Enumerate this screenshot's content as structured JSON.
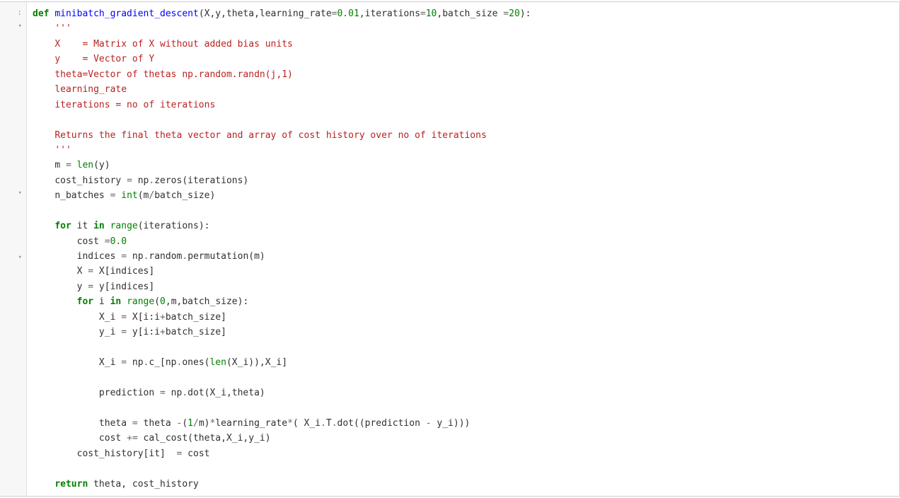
{
  "prompt_label": ":",
  "fold_markers": {
    "line1": "▾",
    "line14": "▾",
    "line19": "▾"
  },
  "code": {
    "lines": [
      {
        "indent": 0,
        "tokens": [
          {
            "cls": "k",
            "t": "def"
          },
          {
            "cls": "n",
            "t": " "
          },
          {
            "cls": "nf",
            "t": "minibatch_gradient_descent"
          },
          {
            "cls": "p",
            "t": "(X,y,theta,learning_rate"
          },
          {
            "cls": "o",
            "t": "="
          },
          {
            "cls": "m",
            "t": "0.01"
          },
          {
            "cls": "p",
            "t": ",iterations"
          },
          {
            "cls": "o",
            "t": "="
          },
          {
            "cls": "m",
            "t": "10"
          },
          {
            "cls": "p",
            "t": ",batch_size "
          },
          {
            "cls": "o",
            "t": "="
          },
          {
            "cls": "m",
            "t": "20"
          },
          {
            "cls": "p",
            "t": "):"
          }
        ]
      },
      {
        "indent": 1,
        "tokens": [
          {
            "cls": "s",
            "t": "'''"
          }
        ]
      },
      {
        "indent": 1,
        "tokens": [
          {
            "cls": "s",
            "t": "X    = Matrix of X without added bias units"
          }
        ]
      },
      {
        "indent": 1,
        "tokens": [
          {
            "cls": "s",
            "t": "y    = Vector of Y"
          }
        ]
      },
      {
        "indent": 1,
        "tokens": [
          {
            "cls": "s",
            "t": "theta=Vector of thetas np.random.randn(j,1)"
          }
        ]
      },
      {
        "indent": 1,
        "tokens": [
          {
            "cls": "s",
            "t": "learning_rate "
          }
        ]
      },
      {
        "indent": 1,
        "tokens": [
          {
            "cls": "s",
            "t": "iterations = no of iterations"
          }
        ]
      },
      {
        "indent": 1,
        "tokens": [
          {
            "cls": "s",
            "t": ""
          }
        ]
      },
      {
        "indent": 1,
        "tokens": [
          {
            "cls": "s",
            "t": "Returns the final theta vector and array of cost history over no of iterations"
          }
        ]
      },
      {
        "indent": 1,
        "tokens": [
          {
            "cls": "s",
            "t": "'''"
          }
        ]
      },
      {
        "indent": 1,
        "tokens": [
          {
            "cls": "n",
            "t": "m "
          },
          {
            "cls": "o",
            "t": "="
          },
          {
            "cls": "n",
            "t": " "
          },
          {
            "cls": "nb",
            "t": "len"
          },
          {
            "cls": "p",
            "t": "(y)"
          }
        ]
      },
      {
        "indent": 1,
        "tokens": [
          {
            "cls": "n",
            "t": "cost_history "
          },
          {
            "cls": "o",
            "t": "="
          },
          {
            "cls": "n",
            "t": " np"
          },
          {
            "cls": "o",
            "t": "."
          },
          {
            "cls": "n",
            "t": "zeros(iterations)"
          }
        ]
      },
      {
        "indent": 1,
        "tokens": [
          {
            "cls": "n",
            "t": "n_batches "
          },
          {
            "cls": "o",
            "t": "="
          },
          {
            "cls": "n",
            "t": " "
          },
          {
            "cls": "nb",
            "t": "int"
          },
          {
            "cls": "p",
            "t": "(m"
          },
          {
            "cls": "o",
            "t": "/"
          },
          {
            "cls": "n",
            "t": "batch_size)"
          }
        ]
      },
      {
        "indent": 1,
        "tokens": [
          {
            "cls": "n",
            "t": ""
          }
        ]
      },
      {
        "indent": 1,
        "tokens": [
          {
            "cls": "k",
            "t": "for"
          },
          {
            "cls": "n",
            "t": " it "
          },
          {
            "cls": "k",
            "t": "in"
          },
          {
            "cls": "n",
            "t": " "
          },
          {
            "cls": "nb",
            "t": "range"
          },
          {
            "cls": "p",
            "t": "(iterations):"
          }
        ]
      },
      {
        "indent": 2,
        "tokens": [
          {
            "cls": "n",
            "t": "cost "
          },
          {
            "cls": "o",
            "t": "="
          },
          {
            "cls": "m",
            "t": "0.0"
          }
        ]
      },
      {
        "indent": 2,
        "tokens": [
          {
            "cls": "n",
            "t": "indices "
          },
          {
            "cls": "o",
            "t": "="
          },
          {
            "cls": "n",
            "t": " np"
          },
          {
            "cls": "o",
            "t": "."
          },
          {
            "cls": "n",
            "t": "random"
          },
          {
            "cls": "o",
            "t": "."
          },
          {
            "cls": "n",
            "t": "permutation(m)"
          }
        ]
      },
      {
        "indent": 2,
        "tokens": [
          {
            "cls": "n",
            "t": "X "
          },
          {
            "cls": "o",
            "t": "="
          },
          {
            "cls": "n",
            "t": " X[indices]"
          }
        ]
      },
      {
        "indent": 2,
        "tokens": [
          {
            "cls": "n",
            "t": "y "
          },
          {
            "cls": "o",
            "t": "="
          },
          {
            "cls": "n",
            "t": " y[indices]"
          }
        ]
      },
      {
        "indent": 2,
        "tokens": [
          {
            "cls": "k",
            "t": "for"
          },
          {
            "cls": "n",
            "t": " i "
          },
          {
            "cls": "k",
            "t": "in"
          },
          {
            "cls": "n",
            "t": " "
          },
          {
            "cls": "nb",
            "t": "range"
          },
          {
            "cls": "p",
            "t": "("
          },
          {
            "cls": "m",
            "t": "0"
          },
          {
            "cls": "p",
            "t": ",m,batch_size):"
          }
        ]
      },
      {
        "indent": 3,
        "tokens": [
          {
            "cls": "n",
            "t": "X_i "
          },
          {
            "cls": "o",
            "t": "="
          },
          {
            "cls": "n",
            "t": " X[i:i"
          },
          {
            "cls": "o",
            "t": "+"
          },
          {
            "cls": "n",
            "t": "batch_size]"
          }
        ]
      },
      {
        "indent": 3,
        "tokens": [
          {
            "cls": "n",
            "t": "y_i "
          },
          {
            "cls": "o",
            "t": "="
          },
          {
            "cls": "n",
            "t": " y[i:i"
          },
          {
            "cls": "o",
            "t": "+"
          },
          {
            "cls": "n",
            "t": "batch_size]"
          }
        ]
      },
      {
        "indent": 3,
        "tokens": [
          {
            "cls": "n",
            "t": ""
          }
        ]
      },
      {
        "indent": 3,
        "tokens": [
          {
            "cls": "n",
            "t": "X_i "
          },
          {
            "cls": "o",
            "t": "="
          },
          {
            "cls": "n",
            "t": " np"
          },
          {
            "cls": "o",
            "t": "."
          },
          {
            "cls": "n",
            "t": "c_[np"
          },
          {
            "cls": "o",
            "t": "."
          },
          {
            "cls": "n",
            "t": "ones("
          },
          {
            "cls": "nb",
            "t": "len"
          },
          {
            "cls": "p",
            "t": "(X_i)),X_i]"
          }
        ]
      },
      {
        "indent": 3,
        "tokens": [
          {
            "cls": "n",
            "t": ""
          }
        ]
      },
      {
        "indent": 3,
        "tokens": [
          {
            "cls": "n",
            "t": "prediction "
          },
          {
            "cls": "o",
            "t": "="
          },
          {
            "cls": "n",
            "t": " np"
          },
          {
            "cls": "o",
            "t": "."
          },
          {
            "cls": "n",
            "t": "dot(X_i,theta)"
          }
        ]
      },
      {
        "indent": 3,
        "tokens": [
          {
            "cls": "n",
            "t": ""
          }
        ]
      },
      {
        "indent": 3,
        "tokens": [
          {
            "cls": "n",
            "t": "theta "
          },
          {
            "cls": "o",
            "t": "="
          },
          {
            "cls": "n",
            "t": " theta "
          },
          {
            "cls": "o",
            "t": "-"
          },
          {
            "cls": "p",
            "t": "("
          },
          {
            "cls": "m",
            "t": "1"
          },
          {
            "cls": "o",
            "t": "/"
          },
          {
            "cls": "n",
            "t": "m)"
          },
          {
            "cls": "o",
            "t": "*"
          },
          {
            "cls": "n",
            "t": "learning_rate"
          },
          {
            "cls": "o",
            "t": "*"
          },
          {
            "cls": "p",
            "t": "( X_i"
          },
          {
            "cls": "o",
            "t": "."
          },
          {
            "cls": "n",
            "t": "T"
          },
          {
            "cls": "o",
            "t": "."
          },
          {
            "cls": "n",
            "t": "dot((prediction "
          },
          {
            "cls": "o",
            "t": "-"
          },
          {
            "cls": "n",
            "t": " y_i)))"
          }
        ]
      },
      {
        "indent": 3,
        "tokens": [
          {
            "cls": "n",
            "t": "cost "
          },
          {
            "cls": "o",
            "t": "+="
          },
          {
            "cls": "n",
            "t": " cal_cost(theta,X_i,y_i)"
          }
        ]
      },
      {
        "indent": 2,
        "tokens": [
          {
            "cls": "n",
            "t": "cost_history[it]  "
          },
          {
            "cls": "o",
            "t": "="
          },
          {
            "cls": "n",
            "t": " cost"
          }
        ]
      },
      {
        "indent": 2,
        "tokens": [
          {
            "cls": "n",
            "t": ""
          }
        ]
      },
      {
        "indent": 1,
        "tokens": [
          {
            "cls": "k",
            "t": "return"
          },
          {
            "cls": "n",
            "t": " theta, cost_history"
          }
        ]
      }
    ]
  }
}
